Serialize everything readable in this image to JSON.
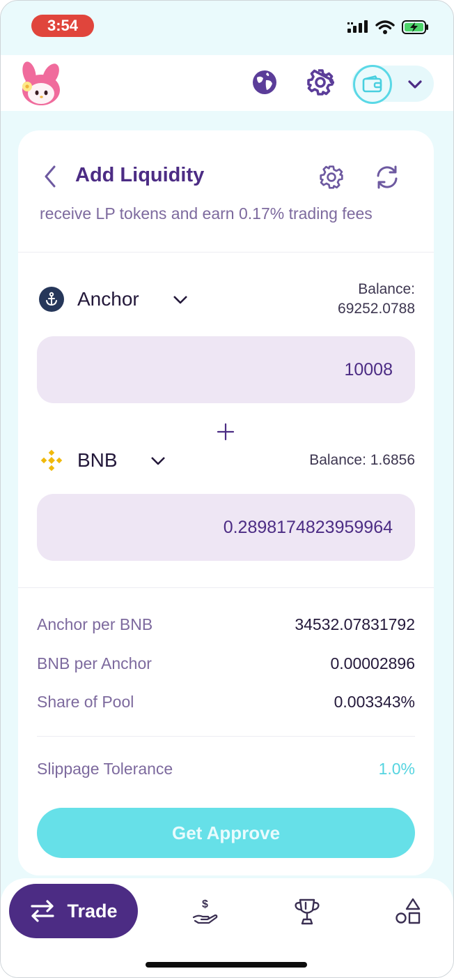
{
  "status_bar": {
    "time": "3:54"
  },
  "header": {
    "logo_icon": "bunny-logo",
    "language_icon": "globe-icon",
    "settings_icon": "gear-icon",
    "wallet_icon": "wallet-icon",
    "wallet_menu_icon": "chevron-down-icon"
  },
  "card": {
    "title": "Add Liquidity",
    "subtitle": "receive LP tokens and earn 0.17% trading fees",
    "token_a": {
      "name": "Anchor",
      "balance_label": "Balance:",
      "balance_value": "69252.0788",
      "amount": "10008"
    },
    "token_b": {
      "name": "BNB",
      "balance": "Balance: 1.6856",
      "amount": "0.2898174823959964"
    },
    "prices": [
      {
        "label": "Anchor per BNB",
        "value": "34532.07831792"
      },
      {
        "label": "BNB per Anchor",
        "value": "0.00002896"
      },
      {
        "label": "Share of Pool",
        "value": "0.003343%"
      }
    ],
    "slippage": {
      "label": "Slippage Tolerance",
      "value": "1.0%"
    },
    "approve_label": "Get Approve"
  },
  "nav": {
    "trade_label": "Trade",
    "items": [
      "trade-icon",
      "earn-icon",
      "trophy-icon",
      "shapes-icon"
    ]
  },
  "colors": {
    "brand_purple": "#4c2c84",
    "accent_cyan": "#66e0e8",
    "field_bg": "#eee6f4",
    "muted_text": "#7d6a9e",
    "background": "#eafafc"
  }
}
